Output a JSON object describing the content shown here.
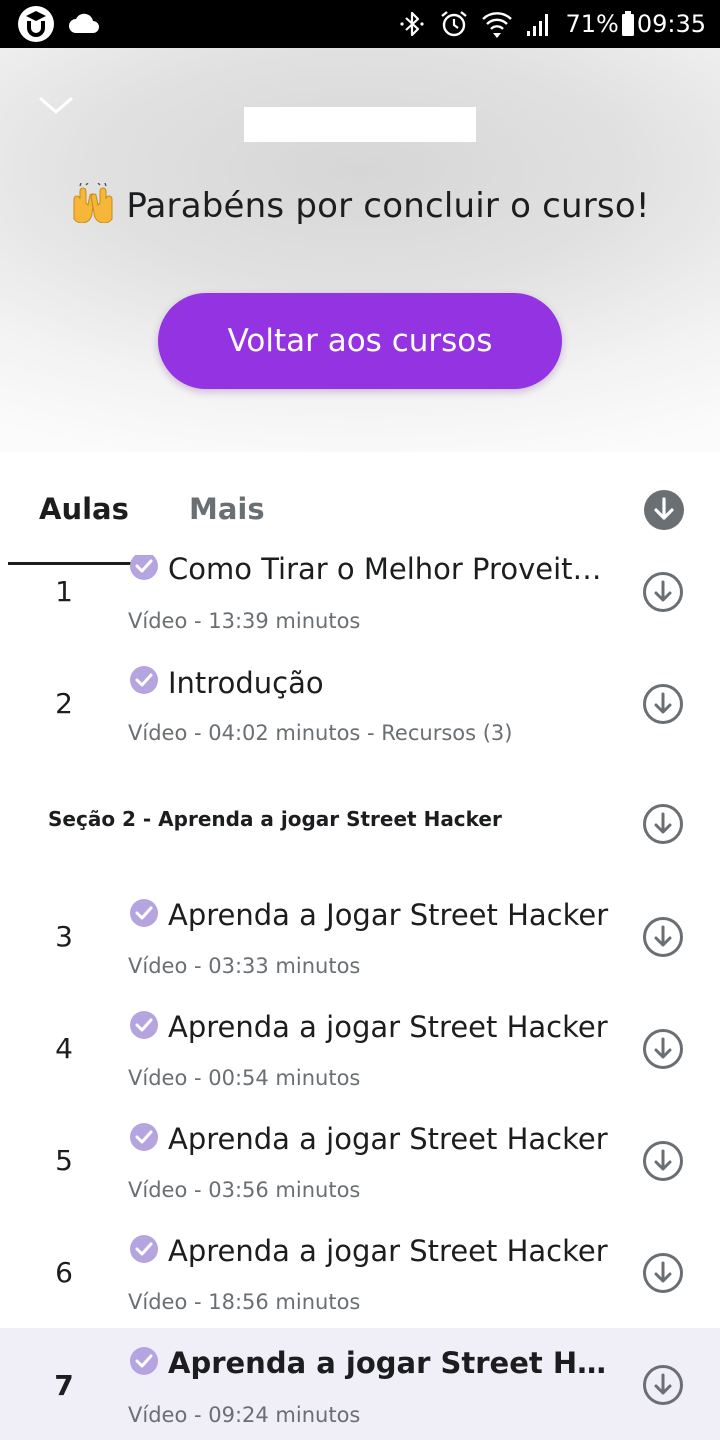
{
  "status_bar": {
    "battery": "71%",
    "time": "09:35",
    "icons": [
      "udemy-app-icon",
      "cloud-icon",
      "bluetooth-icon",
      "alarm-icon",
      "wifi-icon",
      "signal-icon",
      "battery-icon"
    ]
  },
  "header": {
    "congrats_text": "Parabéns por concluir o curso!",
    "congrats_emoji": "raising-hands-icon",
    "back_button_label": "Voltar aos cursos"
  },
  "tabs": {
    "items": [
      {
        "label": "Aulas",
        "active": true
      },
      {
        "label": "Mais",
        "active": false
      }
    ]
  },
  "colors": {
    "accent": "#9333e1",
    "check": "#b6a4e0",
    "text": "#1c1d1f",
    "muted": "#6a6f73",
    "active_row": "#f0eef7"
  },
  "lectures_a": [
    {
      "number": "1",
      "title": "Como Tirar o Melhor Proveito desse Curso",
      "meta": "Vídeo - 13:39 minutos",
      "completed": true
    },
    {
      "number": "2",
      "title": "Introdução",
      "meta": "Vídeo - 04:02 minutos - Recursos (3)",
      "completed": true
    }
  ],
  "section": {
    "title": "Seção 2 - Aprenda a jogar Street Hacker"
  },
  "lectures_b": [
    {
      "number": "3",
      "title": "Aprenda a Jogar Street Hacker",
      "meta": "Vídeo - 03:33 minutos",
      "completed": true
    },
    {
      "number": "4",
      "title": "Aprenda a jogar Street Hacker",
      "meta": "Vídeo - 00:54 minutos",
      "completed": true
    },
    {
      "number": "5",
      "title": "Aprenda a jogar Street Hacker",
      "meta": "Vídeo - 03:56 minutos",
      "completed": true
    },
    {
      "number": "6",
      "title": "Aprenda a jogar Street Hacker",
      "meta": "Vídeo - 18:56 minutos",
      "completed": true
    },
    {
      "number": "7",
      "title": "Aprenda a jogar Street Hacker",
      "meta": "Vídeo - 09:24 minutos",
      "completed": true,
      "active": true
    }
  ]
}
